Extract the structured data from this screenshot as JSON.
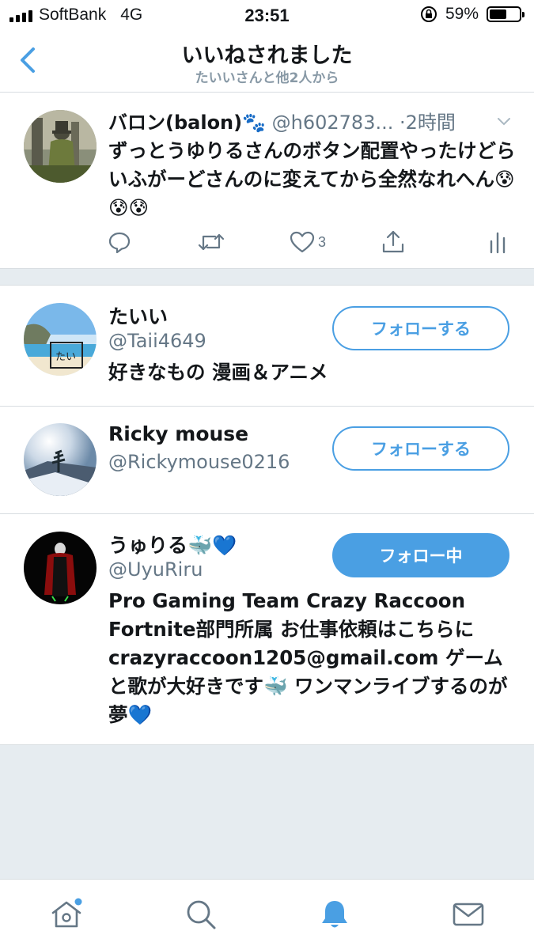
{
  "status_bar": {
    "carrier": "SoftBank",
    "network": "4G",
    "time": "23:51",
    "battery": "59%",
    "battery_level": 0.59
  },
  "header": {
    "title": "いいねされました",
    "subtitle": "たいいさんと他2人から",
    "back_icon": "chevron-left-icon"
  },
  "tweet": {
    "author_name": "バロン(balon)🐾",
    "author_handle": "@h602783...",
    "time": "·2時間",
    "text": "ずっとうゆりるさんのボタン配置やったけどらいふがーどさんのに変えてから全然なれへん😰😰😰",
    "actions": {
      "reply_icon": "reply-icon",
      "retweet_icon": "retweet-icon",
      "like_icon": "heart-icon",
      "like_count": "3",
      "share_icon": "share-icon",
      "analytics_icon": "analytics-icon"
    }
  },
  "users": [
    {
      "name": "たいい",
      "handle": "@Taii4649",
      "bio": "好きなもの 漫画＆アニメ",
      "button": "フォローする",
      "following": false
    },
    {
      "name": "Ricky mouse",
      "handle": "@Rickymouse0216",
      "bio": "",
      "button": "フォローする",
      "following": false
    },
    {
      "name": "うゅりる🐳💙",
      "handle": "@UyuRiru",
      "bio": "Pro Gaming Team Crazy Raccoon Fortnite部門所属 お仕事依頼はこちらに crazyraccoon1205@gmail.com ゲームと歌が大好きです🐳 ワンマンライブするのが夢💙",
      "button": "フォロー中",
      "following": true
    }
  ],
  "tabbar": {
    "items": [
      "home-icon",
      "search-icon",
      "notifications-icon",
      "messages-icon"
    ],
    "active": "notifications-icon"
  },
  "colors": {
    "accent": "#4a9fe3",
    "secondary_text": "#657786",
    "background": "#e6ecf0"
  }
}
